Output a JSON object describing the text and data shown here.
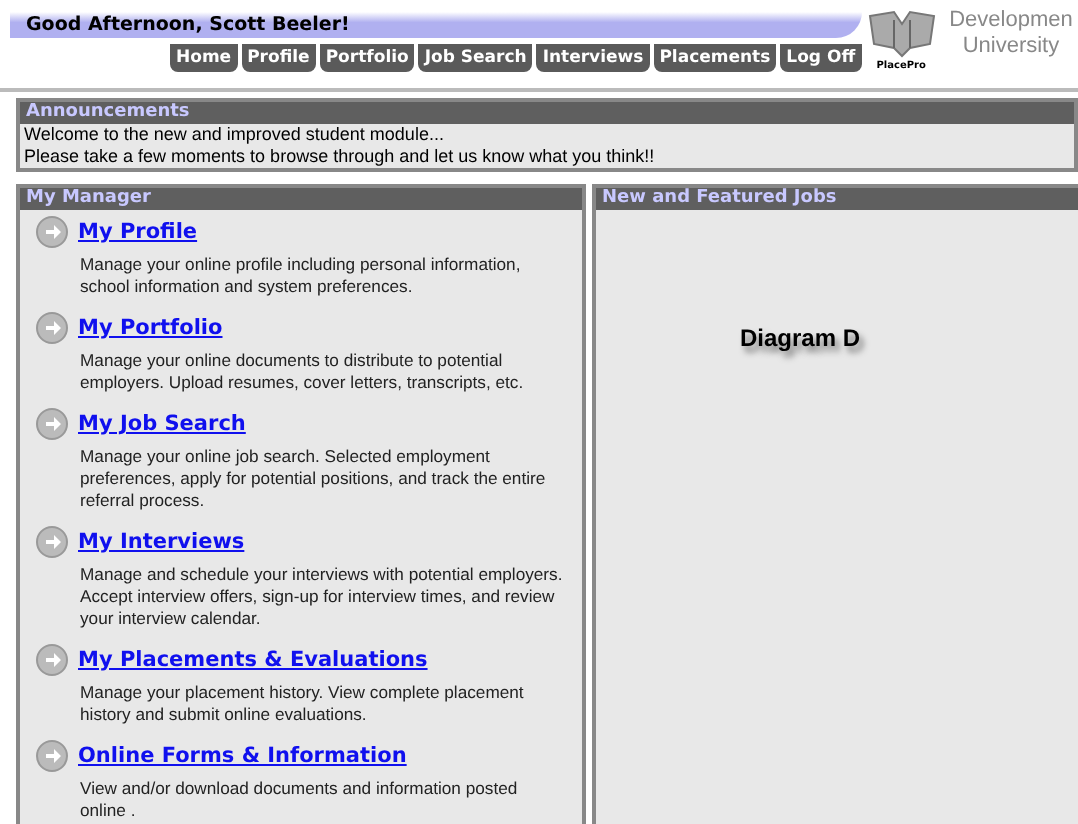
{
  "greeting": "Good Afternoon, Scott Beeler!",
  "nav": [
    "Home",
    "Profile",
    "Portfolio",
    "Job Search",
    "Interviews",
    "Placements",
    "Log Off"
  ],
  "logo": {
    "mark": "PlacePro",
    "name_lines": [
      "Developmen",
      "University"
    ]
  },
  "announcements": {
    "title": "Announcements",
    "lines": [
      "Welcome to the new and improved student module...",
      "Please take a few moments to browse through and let us know what you think!!"
    ]
  },
  "manager": {
    "title": "My Manager",
    "items": [
      {
        "link": "My Profile",
        "description": "Manage your online profile including personal information, school information and system preferences."
      },
      {
        "link": "My Portfolio",
        "description": "Manage your online documents to distribute to potential employers. Upload resumes, cover letters, transcripts, etc."
      },
      {
        "link": "My Job Search",
        "description": "Manage your online job search. Selected employment preferences, apply for potential positions, and track the entire referral process."
      },
      {
        "link": "My Interviews",
        "description": "Manage and schedule your interviews with potential employers. Accept interview offers, sign-up for interview times, and review your interview calendar."
      },
      {
        "link": "My Placements & Evaluations",
        "description": "Manage your placement history. View complete placement history and submit online evaluations."
      },
      {
        "link": "Online Forms & Information",
        "description": "View and/or download documents and information posted online ."
      }
    ]
  },
  "jobs": {
    "title": "New and Featured Jobs",
    "caption": "Diagram D"
  }
}
